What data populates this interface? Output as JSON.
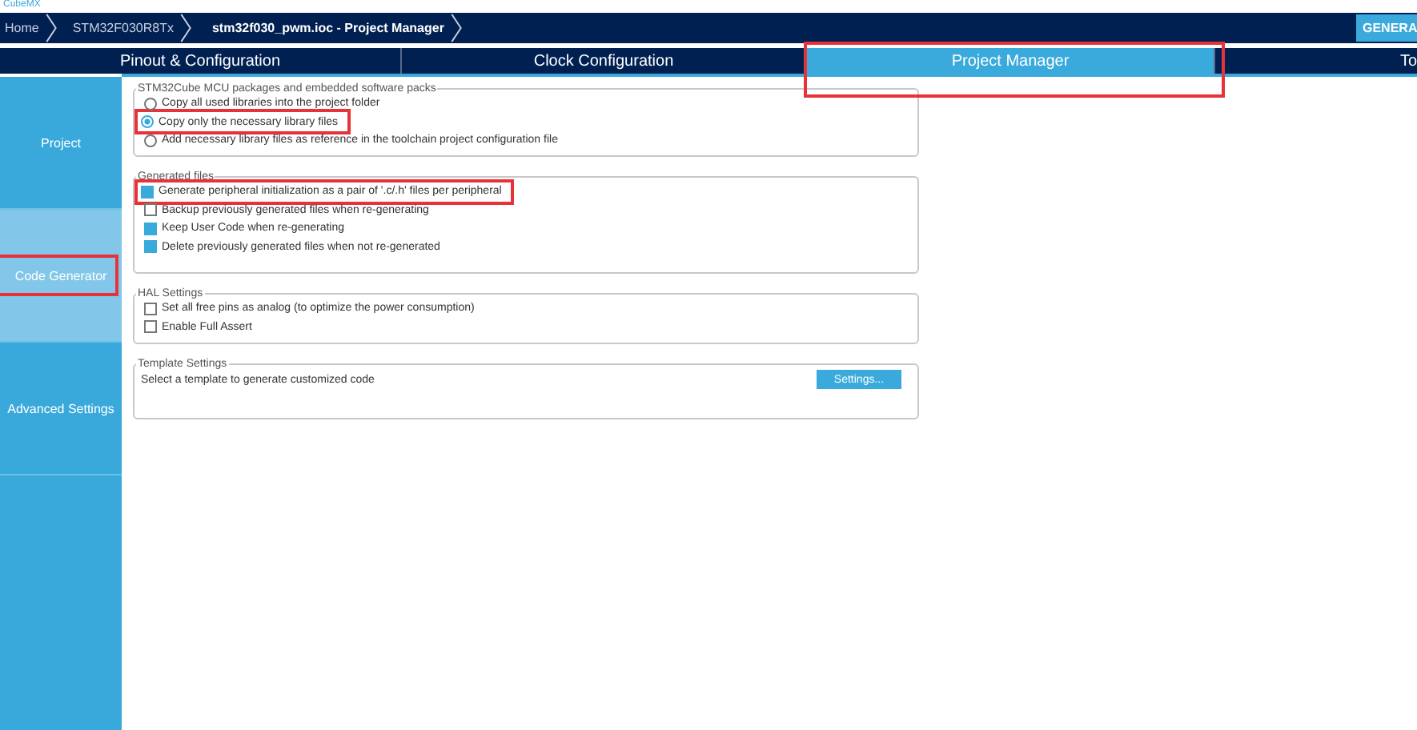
{
  "app_title": "CubeMX",
  "breadcrumbs": [
    {
      "label": "Home",
      "current": false
    },
    {
      "label": "STM32F030R8Tx",
      "current": false
    },
    {
      "label": "stm32f030_pwm.ioc - Project Manager",
      "current": true
    }
  ],
  "generate_button": "GENERA",
  "tabs": [
    {
      "label": "Pinout & Configuration",
      "selected": false,
      "highlighted": false
    },
    {
      "label": "Clock Configuration",
      "selected": false,
      "highlighted": false
    },
    {
      "label": "Project Manager",
      "selected": true,
      "highlighted": true
    },
    {
      "label": "To",
      "selected": false,
      "highlighted": false
    }
  ],
  "sidebar": {
    "items": [
      {
        "label": "Project",
        "selected": false,
        "highlighted": false
      },
      {
        "label": "Code Generator",
        "selected": true,
        "highlighted": true
      },
      {
        "label": "Advanced Settings",
        "selected": false,
        "highlighted": false
      }
    ]
  },
  "groups": [
    {
      "title": "STM32Cube MCU packages and embedded software packs",
      "options": [
        {
          "kind": "radio",
          "label": "Copy all used libraries into the project folder",
          "checked": false,
          "highlighted": false
        },
        {
          "kind": "radio",
          "label": "Copy only the necessary library files",
          "checked": true,
          "highlighted": true
        },
        {
          "kind": "radio",
          "label": "Add necessary library files as reference in the toolchain project configuration file",
          "checked": false,
          "highlighted": false
        }
      ]
    },
    {
      "title": "Generated files",
      "options": [
        {
          "kind": "checkbox",
          "label": "Generate peripheral initialization as a pair of '.c/.h' files per peripheral",
          "checked": true,
          "highlighted": true
        },
        {
          "kind": "checkbox",
          "label": "Backup previously generated files when re-generating",
          "checked": false,
          "highlighted": false
        },
        {
          "kind": "checkbox",
          "label": "Keep User Code when re-generating",
          "checked": true,
          "highlighted": false
        },
        {
          "kind": "checkbox",
          "label": "Delete previously generated files when not re-generated",
          "checked": true,
          "highlighted": false
        }
      ]
    },
    {
      "title": "HAL Settings",
      "options": [
        {
          "kind": "checkbox",
          "label": "Set all free pins as analog (to optimize the power consumption)",
          "checked": false,
          "highlighted": false
        },
        {
          "kind": "checkbox",
          "label": "Enable Full Assert",
          "checked": false,
          "highlighted": false
        }
      ]
    },
    {
      "title": "Template Settings",
      "options": [
        {
          "kind": "text",
          "label": "Select a template to generate customized code",
          "button": "Settings..."
        }
      ]
    }
  ]
}
